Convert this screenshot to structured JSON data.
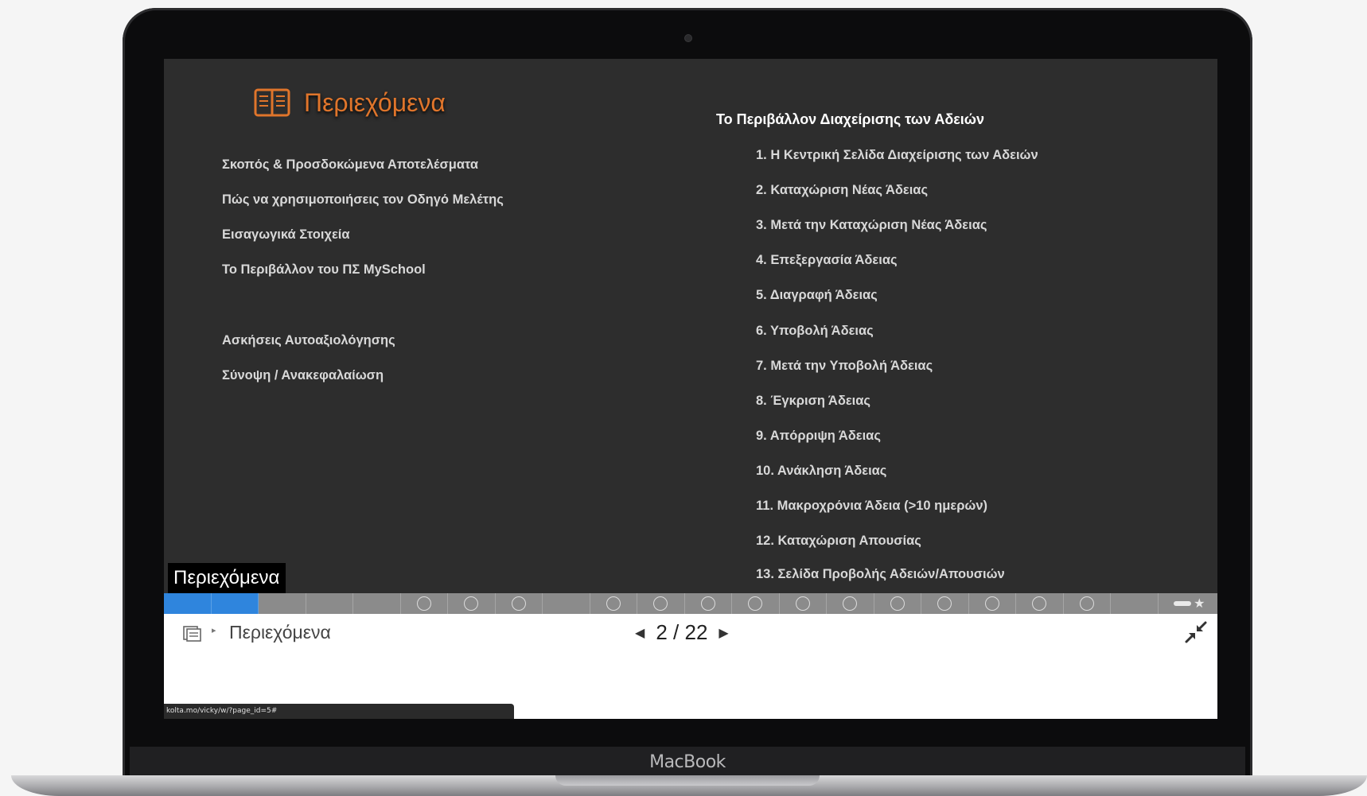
{
  "toc": {
    "title": "Περιεχόμενα",
    "left_items": [
      "Σκοπός & Προσδοκώμενα Αποτελέσματα",
      "Πώς να χρησιμοποιήσεις τον Οδηγό Μελέτης",
      "Εισαγωγικά Στοιχεία",
      "Το Περιβάλλον του ΠΣ MySchool",
      "Ασκήσεις Αυτοαξιολόγησης",
      "Σύνοψη / Ανακεφαλαίωση"
    ],
    "right_heading": "Το Περιβάλλον Διαχείρισης των Αδειών",
    "right_items": [
      "1. Η Κεντρική Σελίδα Διαχείρισης των Αδειών",
      "2. Καταχώριση Νέας Άδειας",
      "3. Μετά την Καταχώριση Νέας Άδειας",
      "4. Επεξεργασία Άδειας",
      "5. Διαγραφή Άδειας",
      "6. Υποβολή Άδειας",
      "7. Μετά την Υποβολή Άδειας",
      "8. Έγκριση Άδειας",
      "9. Απόρριψη Άδειας",
      "10. Ανάκληση Άδειας",
      "11. Μακροχρόνια Άδεια (>10 ημερών)",
      "12. Καταχώριση Απουσίας",
      "13. Σελίδα Προβολής Αδειών/Απουσιών"
    ]
  },
  "page_label": "Περιεχόμενα",
  "progress": {
    "segments": [
      "done",
      "done",
      "empty",
      "empty",
      "empty",
      "circle",
      "circle",
      "circle",
      "empty",
      "circle",
      "circle",
      "circle",
      "circle",
      "circle",
      "circle",
      "circle",
      "circle",
      "circle",
      "circle",
      "circle",
      "empty",
      "end"
    ]
  },
  "navbar": {
    "crumb_label": "Περιεχόμενα",
    "page_current": "2",
    "page_separator": "/",
    "page_total": "22"
  },
  "status_url": "kolta.mo/vicky/w/?page_id=5#",
  "device": {
    "brand": "MacBook"
  },
  "colors": {
    "accent": "#e0752b",
    "progress_done": "#2f85dd",
    "slide_bg": "#2d2d2d"
  },
  "icons": {
    "toc": "book-icon",
    "menu": "toc-menu-icon",
    "prev": "prev-arrow-icon",
    "next": "next-arrow-icon",
    "fullscreen": "shrink-icon",
    "favorite": "star-icon"
  }
}
